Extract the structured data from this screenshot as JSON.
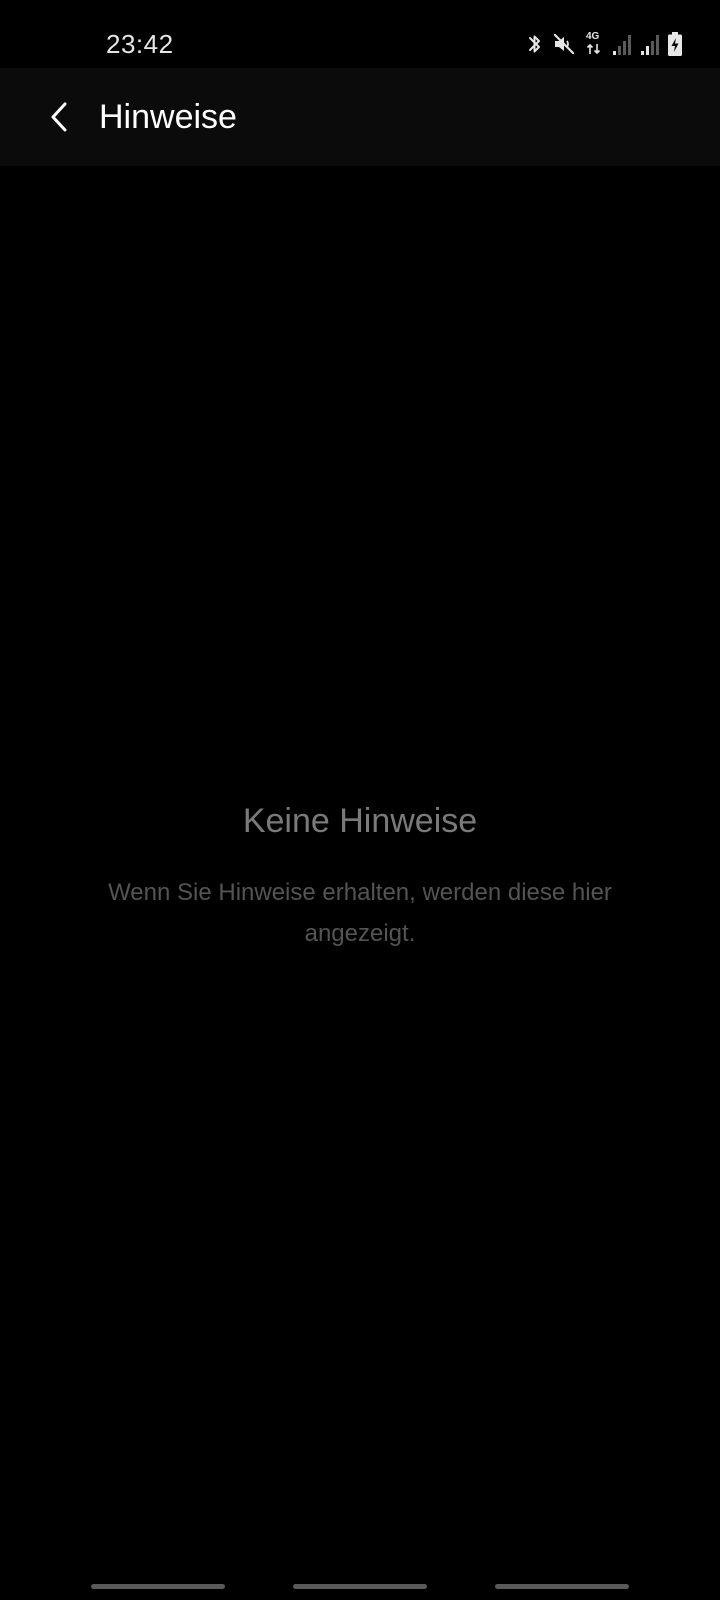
{
  "status_bar": {
    "time": "23:42",
    "network_type": "4G",
    "icons": [
      "bluetooth-icon",
      "muted-icon",
      "network-4g-icon",
      "signal-icon",
      "signal-icon",
      "battery-charging-icon"
    ]
  },
  "app_bar": {
    "title": "Hinweise",
    "back_icon": "chevron-left-icon"
  },
  "empty_state": {
    "title": "Keine Hinweise",
    "description": "Wenn Sie Hinweise erhalten, werden diese hier angezeigt."
  },
  "colors": {
    "background": "#000000",
    "app_bar": "#0b0b0b",
    "title_text": "#ffffff",
    "empty_title": "#7a7a7a",
    "empty_desc": "#545454"
  }
}
